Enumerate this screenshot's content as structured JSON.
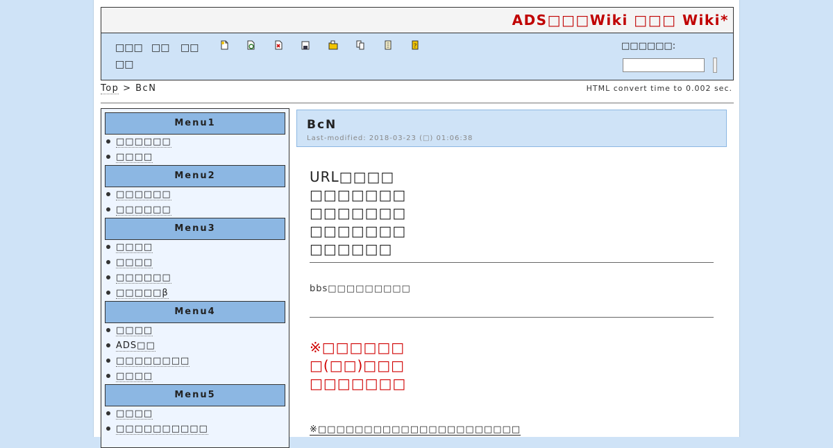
{
  "header": {
    "site_title": "ADS□□□Wiki □□□ Wiki*"
  },
  "toolbar": {
    "nav_links": [
      "□□□",
      "□□",
      "□□",
      "□□"
    ],
    "icons": [
      "new-page-icon",
      "reload-icon",
      "edit-icon",
      "save-icon",
      "folder-icon",
      "copy-icon",
      "list-icon",
      "help-icon"
    ],
    "search_label": "□□□□□□:",
    "search_value": ""
  },
  "breadcrumb": {
    "top_link": "Top",
    "separator": ">",
    "current": "BcN"
  },
  "convert_time": "HTML convert time to 0.002 sec.",
  "sidebar": {
    "menus": [
      {
        "title": "Menu1",
        "items": [
          "□□□□□□",
          "□□□□"
        ]
      },
      {
        "title": "Menu2",
        "items": [
          "□□□□□□",
          "□□□□□□"
        ]
      },
      {
        "title": "Menu3",
        "items": [
          "□□□□",
          "□□□□",
          "□□□□□□",
          "□□□□□β"
        ]
      },
      {
        "title": "Menu4",
        "items": [
          "□□□□",
          "ADS□□",
          "□□□□□□□□",
          "□□□□"
        ]
      },
      {
        "title": "Menu5",
        "items": [
          "□□□□",
          "□□□□□□□□□□"
        ]
      }
    ]
  },
  "content": {
    "title": "BcN",
    "last_modified": "Last-modified: 2018-03-23 (□) 01:06:38",
    "lead_lines": [
      "URL□□□□",
      "□□□□□□□",
      "□□□□□□□",
      "□□□□□□□",
      "□□□□□□"
    ],
    "bbs_text": "bbs□□□□□□□□□",
    "warning_lines": [
      "※□□□□□□",
      "□(□□)□□□",
      "□□□□□□□"
    ],
    "footnote": "※□□□□□□□□□□□□□□□□□□□□□□"
  },
  "colors": {
    "background": "#cfe3f7",
    "menu_header": "#8cb7e3",
    "title_red": "#c00000",
    "warning_red": "#d00000"
  }
}
